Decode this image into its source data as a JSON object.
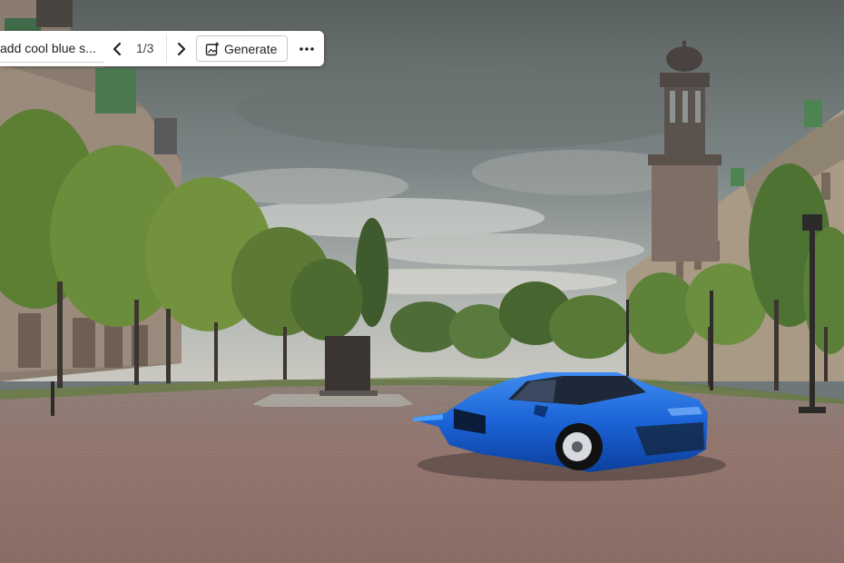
{
  "toolbar": {
    "prompt_text": "add cool blue s...",
    "counter": "1/3",
    "generate_label": "Generate"
  },
  "icons": {
    "prev": "chevron-left-icon",
    "next": "chevron-right-icon",
    "generate": "generate-image-icon",
    "more": "more-horizontal-icon"
  },
  "image": {
    "subject": "blue sports car"
  }
}
